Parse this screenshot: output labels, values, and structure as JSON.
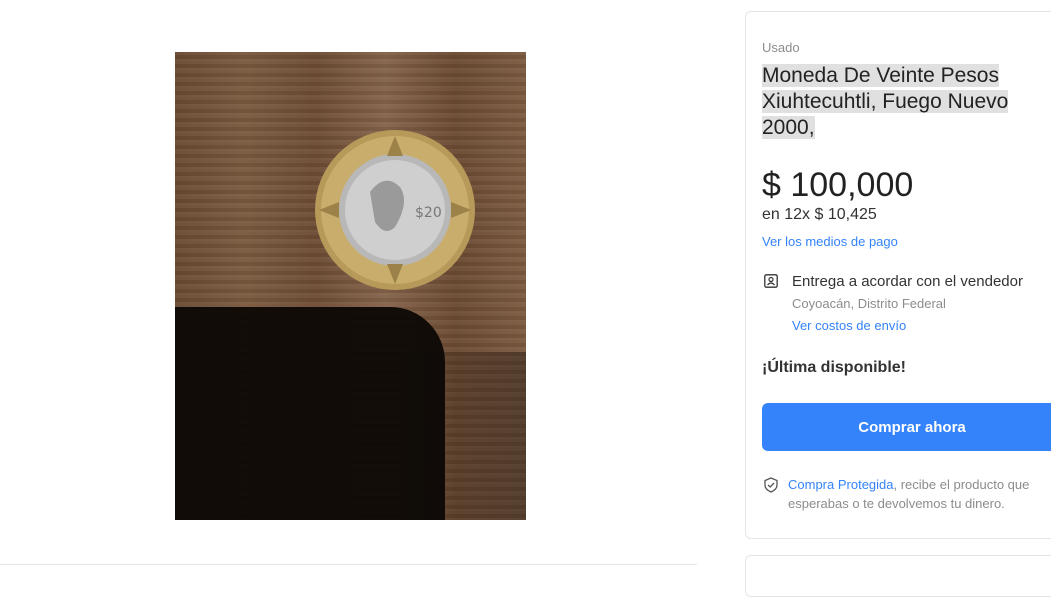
{
  "product": {
    "condition": "Usado",
    "title": "Moneda De Veinte Pesos Xiuhtecuhtli, Fuego Nuevo 2000,",
    "price": "$ 100,000",
    "installments": "en 12x $ 10,425",
    "payment_link": "Ver los medios de pago"
  },
  "shipping": {
    "icon": "person-card-icon",
    "title": "Entrega a acordar con el vendedor",
    "location": "Coyoacán, Distrito Federal",
    "cost_link": "Ver costos de envío"
  },
  "stock": "¡Última disponible!",
  "buy_button": "Comprar ahora",
  "protection": {
    "icon": "shield-check-icon",
    "link": "Compra Protegida",
    "text": ", recibe el producto que esperabas o te devolvemos tu dinero."
  },
  "gallery": {
    "image_alt": "coin-photo"
  },
  "colors": {
    "accent": "#3483fa",
    "muted": "#8c8c8c"
  }
}
